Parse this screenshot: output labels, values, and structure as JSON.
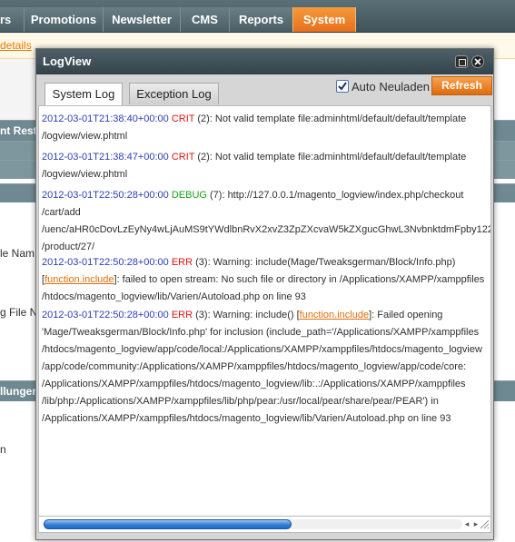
{
  "topnav": {
    "tabs": [
      {
        "label": "rs"
      },
      {
        "label": "Promotions"
      },
      {
        "label": "Newsletter"
      },
      {
        "label": "CMS"
      },
      {
        "label": "Reports"
      },
      {
        "label": "System"
      }
    ],
    "active_color": "#eb7a1f"
  },
  "notice": {
    "link": "details"
  },
  "background": {
    "bar1": "nt Restr",
    "label1": "le Nam",
    "label2": "g File N",
    "bar2": "llunger",
    "trail": "n"
  },
  "dialog": {
    "title": "LogView",
    "tabs": {
      "system": "System Log",
      "exception": "Exception Log"
    },
    "auto_reload": {
      "label": "Auto Neuladen",
      "checked": true
    },
    "refresh_label": "Refresh",
    "log": [
      {
        "timestamp": "2012-03-01T21:38:40+00:00",
        "level": "CRIT",
        "lines": [
          " (2): Not valid template file:adminhtml/default/default/template",
          "/logview/view.phtml"
        ]
      },
      {
        "timestamp": "2012-03-01T21:38:47+00:00",
        "level": "CRIT",
        "lines": [
          " (2): Not valid template file:adminhtml/default/default/template",
          "/logview/view.phtml"
        ]
      },
      {
        "timestamp": "2012-03-01T22:50:28+00:00",
        "level": "DEBUG",
        "lines": [
          " (7): http://127.0.0.1/magento_logview/index.php/checkout",
          "/cart/add",
          "/uenc/aHR0cDovLzEyNy4wLjAuMS9tYWdlbnRvX2xvZ3ZpZXcvaW5kZXguc…",
          "/product/27/"
        ],
        "line3_full": "/uenc/aHR0cDovLzEyNy4wLjAuMS9tYWdlbnRvX2xvZ3ZpZXcvaW5kZXgucGhwL3NvbnktdmFpby122"
      },
      {
        "timestamp": "2012-03-01T22:50:28+00:00",
        "level": "ERR",
        "lines": [
          " (3): Warning: include(Mage/Tweaksgerman/Block/Info.php)",
          "[",
          "function.include",
          "]: failed to open stream: No such file or directory in /Applications/XAMPP/xamppfiles",
          "/htdocs/magento_logview/lib/Varien/Autoload.php on line 93"
        ]
      },
      {
        "timestamp": "2012-03-01T22:50:28+00:00",
        "level": "ERR",
        "lines": [
          " (3): Warning: include() [",
          "function.include",
          "]: Failed opening",
          "'Mage/Tweaksgerman/Block/Info.php' for inclusion (include_path='/Applications/XAMPP/xamppfiles",
          "/htdocs/magento_logview/app/code/local:/Applications/XAMPP/xamppfiles/htdocs/magento_logview",
          "/app/code/community:/Applications/XAMPP/xamppfiles/htdocs/magento_logview/app/code/core:",
          "/Applications/XAMPP/xamppfiles/htdocs/magento_logview/lib:.:/Applications/XAMPP/xamppfiles",
          "/lib/php:/Applications/XAMPP/xamppfiles/lib/php/pear:/usr/local/pear/share/pear/PEAR') in",
          "/Applications/XAMPP/xamppfiles/htdocs/magento_logview/lib/Varien/Autoload.php on line 93"
        ]
      }
    ],
    "scroll_position": 0.0
  }
}
